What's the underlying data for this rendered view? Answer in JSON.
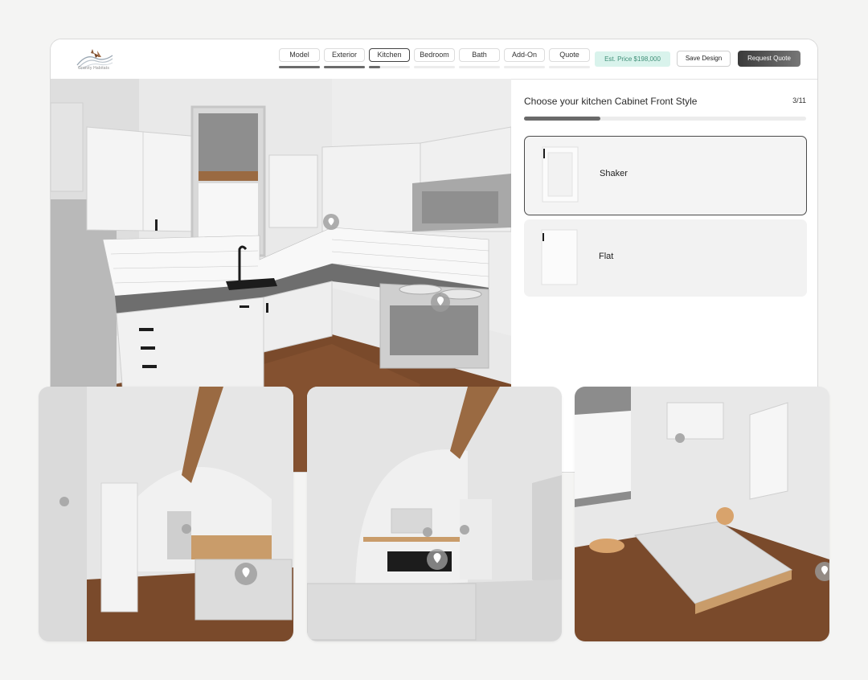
{
  "brand": {
    "logo_text": "Granity Habitats"
  },
  "steps": [
    {
      "label": "Model",
      "progress": 1.0,
      "active": false
    },
    {
      "label": "Exterior",
      "progress": 1.0,
      "active": false
    },
    {
      "label": "Kitchen",
      "progress": 0.27,
      "active": true
    },
    {
      "label": "Bedroom",
      "progress": 0,
      "active": false
    },
    {
      "label": "Bath",
      "progress": 0,
      "active": false
    },
    {
      "label": "Add-On",
      "progress": 0,
      "active": false
    },
    {
      "label": "Quote",
      "progress": 0,
      "active": false
    }
  ],
  "header": {
    "price_label": "Est. Price $198,000",
    "save_label": "Save Design",
    "quote_label": "Request Quote"
  },
  "panel": {
    "question": "Choose your kitchen Cabinet Front Style",
    "counter": "3/11",
    "progress": 0.27,
    "options": [
      {
        "label": "Shaker",
        "selected": true
      },
      {
        "label": "Flat",
        "selected": false
      }
    ]
  },
  "colors": {
    "accent_dark": "#3a3a3a",
    "price_bg": "#d9f3ec",
    "price_text": "#3f8f77",
    "wood_floor": "#7a4a2b"
  },
  "icons": [
    "location-pin-icon"
  ]
}
